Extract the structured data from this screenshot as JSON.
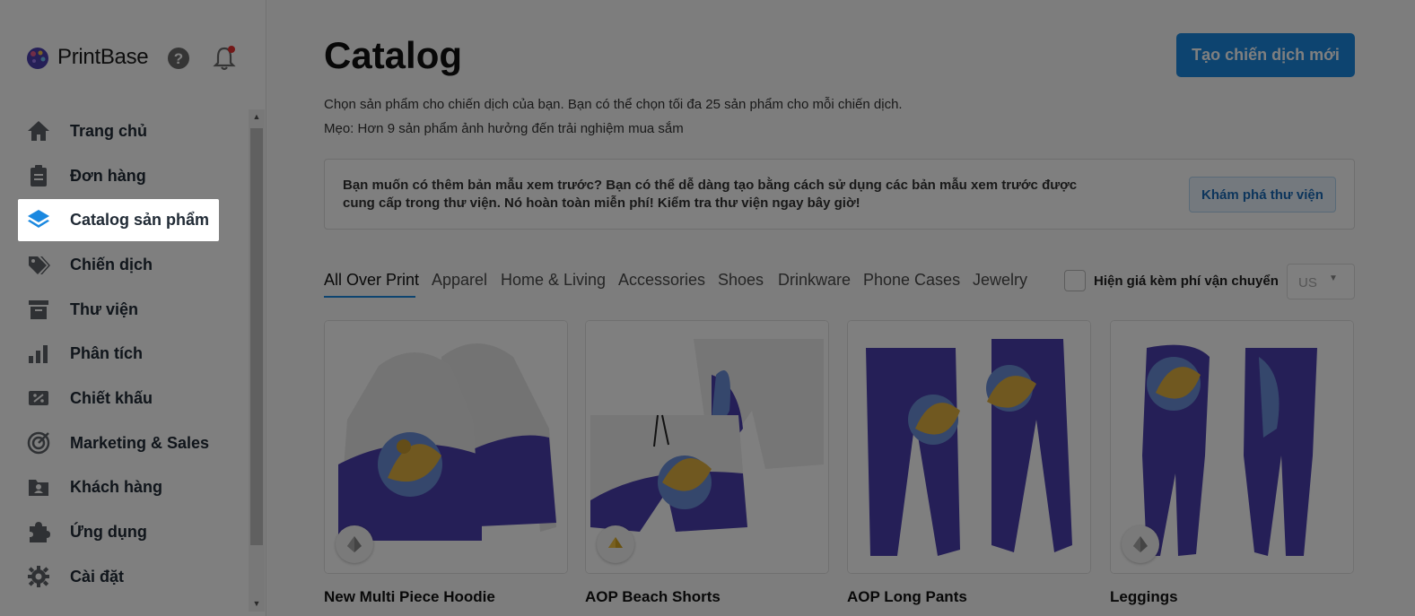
{
  "brand": {
    "name": "PrintBase"
  },
  "sidebar": {
    "items": [
      {
        "label": "Trang chủ",
        "icon": "home-icon"
      },
      {
        "label": "Đơn hàng",
        "icon": "clipboard-icon"
      },
      {
        "label": "Catalog sản phẩm",
        "icon": "layers-icon"
      },
      {
        "label": "Chiến dịch",
        "icon": "tags-icon"
      },
      {
        "label": "Thư viện",
        "icon": "archive-icon"
      },
      {
        "label": "Phân tích",
        "icon": "bar-chart-icon"
      },
      {
        "label": "Chiết khấu",
        "icon": "discount-icon"
      },
      {
        "label": "Marketing & Sales",
        "icon": "target-icon"
      },
      {
        "label": "Khách hàng",
        "icon": "customer-folder-icon"
      },
      {
        "label": "Ứng dụng",
        "icon": "puzzle-icon"
      },
      {
        "label": "Cài đặt",
        "icon": "gear-icon"
      }
    ],
    "active_index": 2
  },
  "header": {
    "title": "Catalog",
    "create_button": "Tạo chiến dịch mới",
    "subtext_1": "Chọn sản phẩm cho chiến dịch của bạn. Bạn có thể chọn tối đa 25 sản phẩm cho mỗi chiến dịch.",
    "subtext_2": "Mẹo: Hơn 9 sản phẩm ảnh hưởng đến trải nghiệm mua sắm"
  },
  "info": {
    "text": "Bạn muốn có thêm bản mẫu xem trước? Bạn có thể dễ dàng tạo bằng cách sử dụng các bản mẫu xem trước được cung cấp trong thư viện. Nó hoàn toàn miễn phí! Kiểm tra thư viện ngay bây giờ!",
    "button": "Khám phá thư viện"
  },
  "tabs": [
    "All Over Print",
    "Apparel",
    "Home & Living",
    "Accessories",
    "Shoes",
    "Drinkware",
    "Phone Cases",
    "Jewelry"
  ],
  "active_tab": "All Over Print",
  "shipping_toggle": {
    "label": "Hiện giá kèm phí vận chuyển",
    "checked": false
  },
  "region_select": {
    "value": "US"
  },
  "products": [
    {
      "title": "New Multi Piece Hoodie",
      "badge": "silver"
    },
    {
      "title": "AOP Beach Shorts",
      "badge": "gold"
    },
    {
      "title": "AOP Long Pants",
      "badge": "none"
    },
    {
      "title": "Leggings",
      "badge": "silver"
    }
  ],
  "colors": {
    "accent": "#1a88e0",
    "product_purple": "#4b3fae",
    "product_gold": "#e0b040",
    "overlay": "rgba(0,0,0,0.5)"
  }
}
